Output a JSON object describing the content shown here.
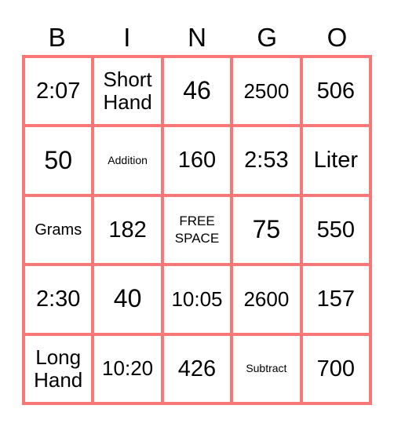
{
  "card": {
    "header": [
      "B",
      "I",
      "N",
      "G",
      "O"
    ],
    "border_color": "#f87878",
    "rows": [
      [
        {
          "text": "2:07",
          "size": "l"
        },
        {
          "text": "Short Hand",
          "size": "m"
        },
        {
          "text": "46",
          "size": "xl"
        },
        {
          "text": "2500",
          "size": "m"
        },
        {
          "text": "506",
          "size": "l"
        }
      ],
      [
        {
          "text": "50",
          "size": "xl"
        },
        {
          "text": "Addition",
          "size": "xxs"
        },
        {
          "text": "160",
          "size": "l"
        },
        {
          "text": "2:53",
          "size": "l"
        },
        {
          "text": "Liter",
          "size": "l"
        }
      ],
      [
        {
          "text": "Grams",
          "size": "s"
        },
        {
          "text": "182",
          "size": "l"
        },
        {
          "text": "FREE SPACE",
          "size": "xs"
        },
        {
          "text": "75",
          "size": "xl"
        },
        {
          "text": "550",
          "size": "l"
        }
      ],
      [
        {
          "text": "2:30",
          "size": "l"
        },
        {
          "text": "40",
          "size": "xl"
        },
        {
          "text": "10:05",
          "size": "m"
        },
        {
          "text": "2600",
          "size": "m"
        },
        {
          "text": "157",
          "size": "l"
        }
      ],
      [
        {
          "text": "Long Hand",
          "size": "m"
        },
        {
          "text": "10:20",
          "size": "m"
        },
        {
          "text": "426",
          "size": "l"
        },
        {
          "text": "Subtract",
          "size": "xxs"
        },
        {
          "text": "700",
          "size": "l"
        }
      ]
    ]
  }
}
